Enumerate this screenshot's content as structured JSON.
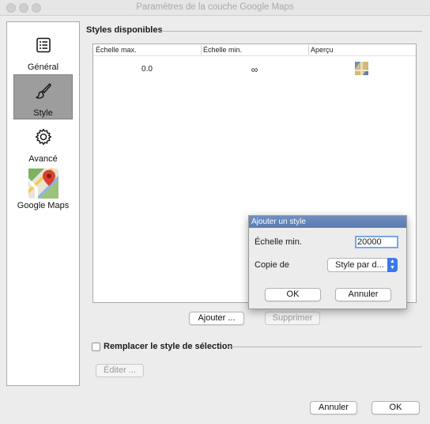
{
  "window": {
    "title": "Paramètres de la couche Google Maps"
  },
  "sidebar": {
    "items": [
      {
        "label": "Général",
        "icon": "list-icon"
      },
      {
        "label": "Style",
        "icon": "brush-icon",
        "active": true
      },
      {
        "label": "Avancé",
        "icon": "gear-icon"
      },
      {
        "label": "Google Maps",
        "icon": "google-maps-icon"
      }
    ]
  },
  "styles_section": {
    "title": "Styles disponibles",
    "columns": [
      "Échelle max.",
      "Échelle min.",
      "Aperçu"
    ],
    "rows": [
      {
        "max": "0.0",
        "min": "∞",
        "preview": "map-thumbnail"
      }
    ],
    "add_label": "Ajouter ...",
    "delete_label": "Supprimer"
  },
  "selection": {
    "label": "Remplacer le style de sélection",
    "checked": false,
    "edit_label": "Éditer ..."
  },
  "footer": {
    "cancel_label": "Annuler",
    "ok_label": "OK"
  },
  "dialog": {
    "title": "Ajouter un style",
    "min_scale_label": "Échelle min.",
    "min_scale_value": "20000",
    "copy_label": "Copie de",
    "copy_value": "Style par d...",
    "ok_label": "OK",
    "cancel_label": "Annuler"
  },
  "colors": {
    "dialog_title_bg": "#5f80b5",
    "select_accent": "#3a7ae8",
    "focus_ring": "#7aa7e6",
    "sidebar_active": "#9d9d9d"
  }
}
